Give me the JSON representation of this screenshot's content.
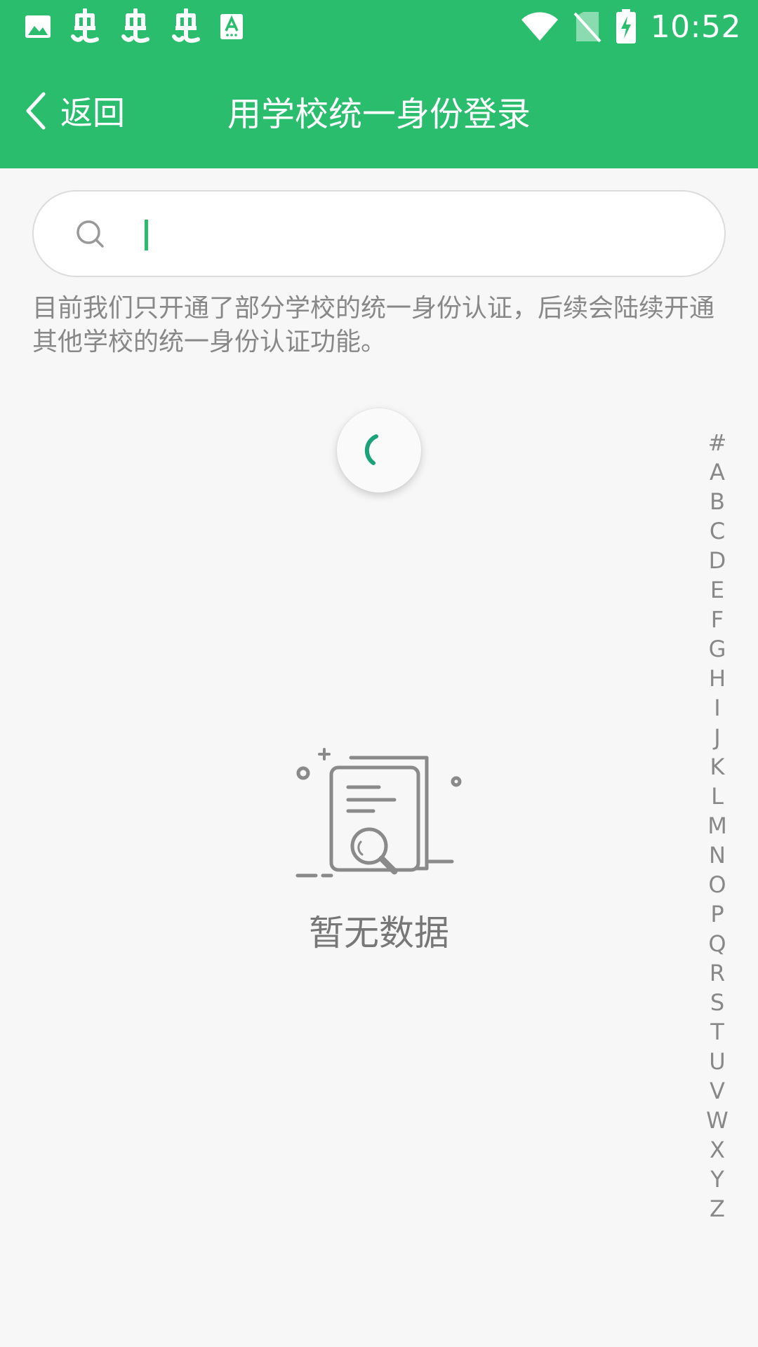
{
  "status_bar": {
    "time": "10:52",
    "left_icons": [
      "image-icon",
      "bug-icon",
      "bug-icon",
      "bug-icon",
      "text-a-icon"
    ],
    "right_icons": [
      "wifi-icon",
      "no-sim-icon",
      "battery-charging-icon"
    ]
  },
  "header": {
    "back_label": "返回",
    "title": "用学校统一身份登录"
  },
  "search": {
    "value": "",
    "placeholder": ""
  },
  "notice": "目前我们只开通了部分学校的统一身份认证，后续会陆续开通其他学校的统一身份认证功能。",
  "empty": {
    "text": "暂无数据"
  },
  "alphabet": [
    "#",
    "A",
    "B",
    "C",
    "D",
    "E",
    "F",
    "G",
    "H",
    "I",
    "J",
    "K",
    "L",
    "M",
    "N",
    "O",
    "P",
    "Q",
    "R",
    "S",
    "T",
    "U",
    "V",
    "W",
    "X",
    "Y",
    "Z"
  ],
  "colors": {
    "primary": "#2bbd6e",
    "spinner": "#1aa37a"
  }
}
